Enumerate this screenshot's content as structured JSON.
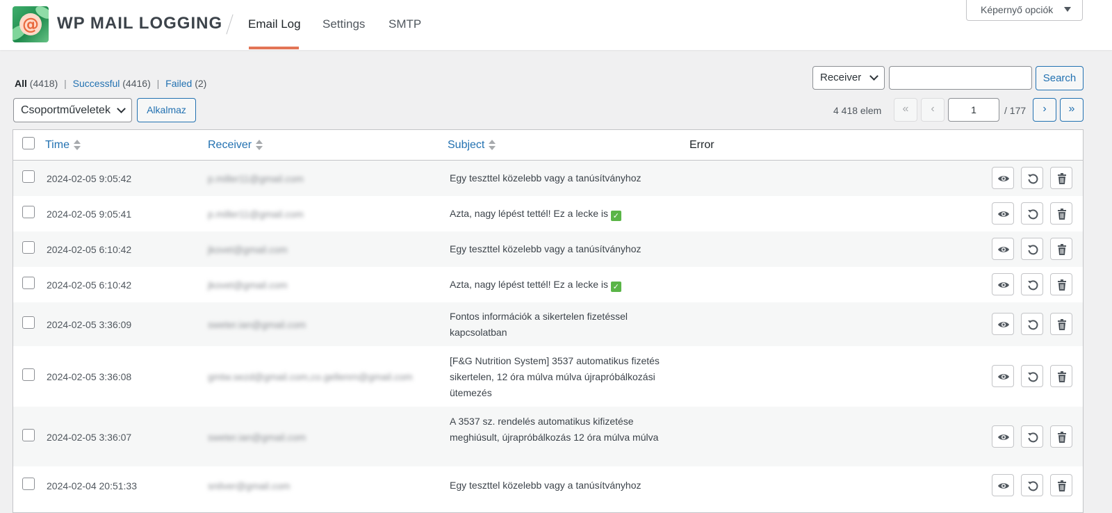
{
  "header": {
    "brand": "WP MAIL LOGGING",
    "tabs": [
      {
        "label": "Email Log",
        "active": true
      },
      {
        "label": "Settings",
        "active": false
      },
      {
        "label": "SMTP",
        "active": false
      }
    ],
    "screen_options": "Képernyő opciók",
    "accent_color": "#e27556"
  },
  "filters": {
    "all_label": "All",
    "all_count": "(4418)",
    "successful_label": "Successful",
    "successful_count": "(4416)",
    "failed_label": "Failed",
    "failed_count": "(2)"
  },
  "search": {
    "field_select": "Receiver",
    "query": "",
    "button": "Search"
  },
  "bulk": {
    "select": "Csoportműveletek",
    "apply": "Alkalmaz"
  },
  "pagination": {
    "items": "4 418 elem",
    "first": "«",
    "prev": "‹",
    "current_page": "1",
    "total_pages": "/ 177",
    "next": "›",
    "last": "»"
  },
  "table": {
    "columns": {
      "time": "Time",
      "receiver": "Receiver",
      "subject": "Subject",
      "error": "Error"
    },
    "rows": [
      {
        "time": "2024-02-05 9:05:42",
        "receiver": "p.miller11@gmail.com",
        "subject": "Egy teszttel közelebb vagy a tanúsítványhoz",
        "check": false,
        "error": ""
      },
      {
        "time": "2024-02-05 9:05:41",
        "receiver": "p.miller11@gmail.com",
        "subject": "Azta, nagy lépést tettél! Ez a lecke is",
        "check": true,
        "error": ""
      },
      {
        "time": "2024-02-05 6:10:42",
        "receiver": "jkovet@gmail.com",
        "subject": "Egy teszttel közelebb vagy a tanúsítványhoz",
        "check": false,
        "error": ""
      },
      {
        "time": "2024-02-05 6:10:42",
        "receiver": "jkovet@gmail.com",
        "subject": "Azta, nagy lépést tettél! Ez a lecke is",
        "check": true,
        "error": ""
      },
      {
        "time": "2024-02-05 3:36:09",
        "receiver": "sweter.ian@gmail.com",
        "subject": "Fontos információk a sikertelen fizetéssel kapcsolatban",
        "check": false,
        "error": ""
      },
      {
        "time": "2024-02-05 3:36:08",
        "receiver": "gmtw.sezd@gmail.com,co.gellenrn@gmail.com",
        "subject": "[F&G Nutrition System] 3537 automatikus fizetés sikertelen, 12 óra múlva múlva újrapróbálkozási ütemezés",
        "check": false,
        "error": ""
      },
      {
        "time": "2024-02-05 3:36:07",
        "receiver": "sweter.ian@gmail.com",
        "subject": "A 3537 sz. rendelés automatikus kifizetése meghiúsult, újrapróbálkozás 12 óra múlva múlva",
        "check": false,
        "error": ""
      },
      {
        "time": "2024-02-04 20:51:33",
        "receiver": "snilver@gmail.com",
        "subject": "Egy teszttel közelebb vagy a tanúsítványhoz",
        "check": false,
        "error": ""
      }
    ],
    "row_actions": [
      "eye-icon",
      "resend-icon",
      "trash-icon"
    ]
  }
}
